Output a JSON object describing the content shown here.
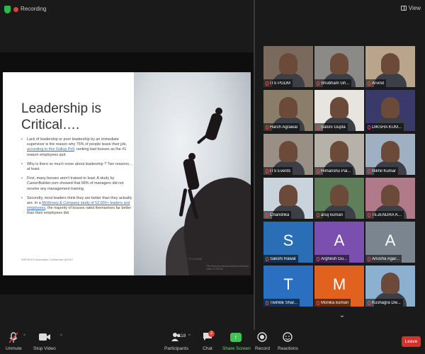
{
  "topbar": {
    "recording_label": "Recording",
    "view_label": "View"
  },
  "slide": {
    "title_line1": "Leadership is",
    "title_line2": "Critical….",
    "bullets": [
      {
        "pre": "Lack of leadership or poor leadership by an immediate supervisor is the reason why 75% of people leave their job, ",
        "link": "according to this Gallup Poll",
        "post": ", ranking bad bosses as the #1 reason employees quit."
      },
      {
        "pre": "Why is there so much noise about leadership ? Two reasons… at least.",
        "link": "",
        "post": ""
      },
      {
        "pre": "First, many bosses aren't trained to lead. A study by CareerBuilder.com showed that 58% of managers did not receive any management training.",
        "link": "",
        "post": ""
      },
      {
        "pre": "Secondly, most leaders think they are better than they actually are. In a ",
        "link": "McKinsey & Company study of 52,000+ leaders and employees",
        "post": ", the majority of bosses rated themselves far better than their employees did."
      }
    ],
    "footer": "INSPIRIUS Associates Confidential @2020",
    "date": "17.12.2020",
    "credit": "This Photo by Unknown Author is licensed under CC BY-SA"
  },
  "participants": [
    {
      "name": "ITS PGDM",
      "initial": "",
      "tile_bg": "#7a6a5e",
      "active": false
    },
    {
      "name": "Shubham Gh...",
      "initial": "",
      "tile_bg": "#8c8a86",
      "active": false
    },
    {
      "name": "Arvind",
      "initial": "",
      "tile_bg": "#b9a48c",
      "active": true
    },
    {
      "name": "Harsh Agrawal",
      "initial": "",
      "tile_bg": "#8a7d6a",
      "active": false
    },
    {
      "name": "Saloni Gupta",
      "initial": "",
      "tile_bg": "#e8e4df",
      "active": false
    },
    {
      "name": "DIKSHA KUM...",
      "initial": "",
      "tile_bg": "#3a3a6a",
      "active": false
    },
    {
      "name": "ITS Events",
      "initial": "",
      "tile_bg": "#9a8f84",
      "active": false
    },
    {
      "name": "Himanshu Pal...",
      "initial": "",
      "tile_bg": "#b7b2a9",
      "active": false
    },
    {
      "name": "Nikhil Kumar",
      "initial": "",
      "tile_bg": "#9fb0c2",
      "active": false
    },
    {
      "name": "Chandrika",
      "initial": "",
      "tile_bg": "#c9d3dc",
      "active": false
    },
    {
      "name": "anuj kumari",
      "initial": "",
      "tile_bg": "#5f7f5a",
      "active": false
    },
    {
      "name": "TEJENDRA K...",
      "initial": "",
      "tile_bg": "#b07a8a",
      "active": false
    },
    {
      "name": "Sakshi Rawat",
      "initial": "S",
      "tile_bg": "#2a6fb5",
      "active": false
    },
    {
      "name": "Arghesh Gu...",
      "initial": "A",
      "tile_bg": "#7a4fb0",
      "active": false
    },
    {
      "name": "Anusha Agar...",
      "initial": "A",
      "tile_bg": "#7b8590",
      "active": false
    },
    {
      "name": "Twinkle Shar...",
      "initial": "T",
      "tile_bg": "#2b6fc0",
      "active": false
    },
    {
      "name": "Monika kumari",
      "initial": "M",
      "tile_bg": "#e0621e",
      "active": false
    },
    {
      "name": "Kushagra Dw...",
      "initial": "",
      "tile_bg": "#8bb0d0",
      "active": false
    }
  ],
  "toolbar": {
    "unmute": "Unmute",
    "stop_video": "Stop Video",
    "participants": "Participants",
    "participants_count": "118",
    "chat": "Chat",
    "chat_badge": "2",
    "share_screen": "Share Screen",
    "record": "Record",
    "reactions": "Reactions",
    "leave": "Leave"
  },
  "colors": {
    "accent_green": "#3ec354",
    "leave_red": "#d9302c",
    "active_speaker": "#7ec63e"
  }
}
